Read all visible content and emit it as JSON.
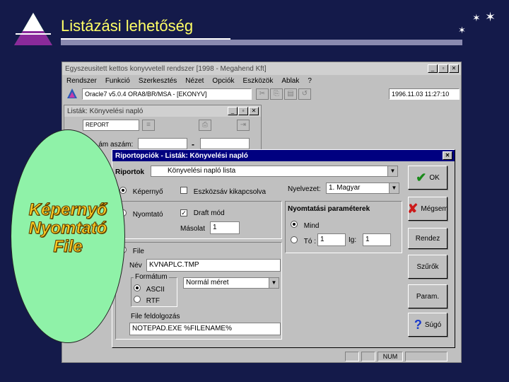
{
  "slide": {
    "title": "Listázási lehetőség"
  },
  "app": {
    "title": "Egyszeusitett kettos konyvvetell rendszer   [1998 - Megahend Kft]",
    "menu": [
      "Rendszer",
      "Funkció",
      "Szerkesztés",
      "Nézet",
      "Opciók",
      "Eszközök",
      "Ablak",
      "?"
    ],
    "connection": "Oracle7  v5.0.4  ORA8/BR/MSA - [EKONYV]",
    "clock": "1996.11.03  11:27:10",
    "window_buttons": [
      "_",
      "▫",
      "✕"
    ]
  },
  "list_window": {
    "title": "Listák: Könyvelési napló",
    "top_field": "REPORT",
    "field_label": "...ám aszám:",
    "dash": "-"
  },
  "dialog": {
    "title": "Riportopciók - Listák: Könyvelési napló",
    "close": "✕",
    "riportok_label": "Riportok",
    "riportok_value": "Könyvelési napló lista",
    "kepernyo_label": "Képernyő",
    "eszkoztar_label": "Eszközsáv kikapcsolva",
    "nyelvezet_label": "Nyelvezet:",
    "nyelvezet_value": "1. Magyar",
    "nyomtato_label": "Nyomtató",
    "draft_label": "Draft mód",
    "masolat_label": "Másolat",
    "masolat_value": "1",
    "nyomtatasi_label": "Nyomtatási paraméterek",
    "mind_label": "Mind",
    "to_label": "Tó :",
    "to_value": "1",
    "ig_label": "Ig:",
    "ig_value": "1",
    "file_label": "File",
    "nev_label": "Név",
    "nev_value": "KVNAPLC.TMP",
    "formatum_label": "Formátum",
    "ascii_label": "ASCII",
    "rtf_label": "RTF",
    "meret_value": "Normál méret",
    "feldolgozas_label": "File feldolgozás",
    "feldolgozas_value": "NOTEPAD.EXE %FILENAME%",
    "buttons": {
      "ok": "OK",
      "megsem": "Mégsem",
      "rendez": "Rendez",
      "szuro": "Szűrők",
      "param": "Param.",
      "sugo": "Súgó"
    }
  },
  "status": {
    "num": "NUM"
  },
  "overlay": {
    "line1": "Képernyő",
    "line2": "Nyomtató",
    "line3": "File"
  },
  "colors": {
    "background": "#141a4a",
    "title": "#ffff66",
    "overlay": "#8ff2a8",
    "overlay_text": "#ffcc22",
    "dialog_titlebar": "#000080"
  }
}
